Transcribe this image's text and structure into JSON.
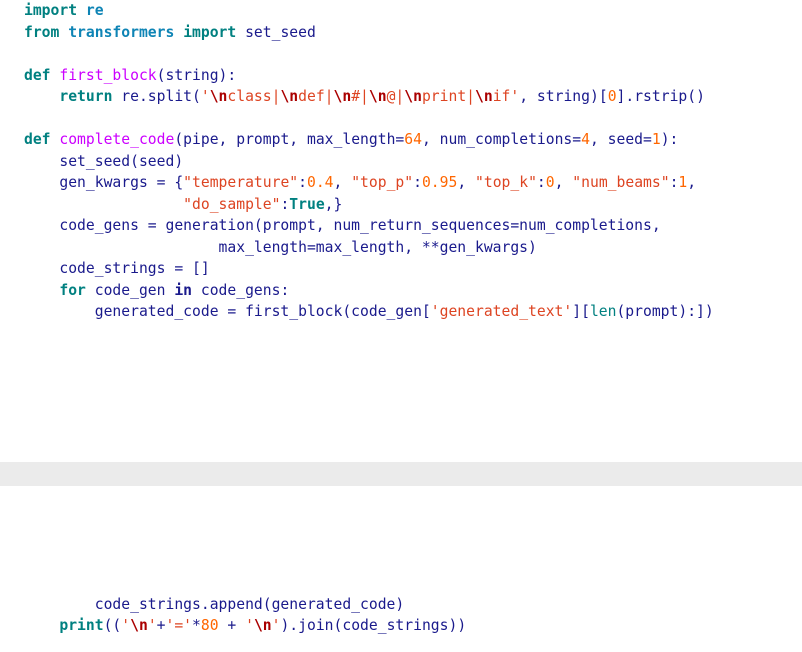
{
  "document": {
    "type": "python-source-listing",
    "language": "Python",
    "background_color": "#ffffff",
    "separator_band_color": "#ebebeb"
  },
  "theme": {
    "keyword_color": "#008080",
    "namespace_color": "#0e84b5",
    "function_name_color": "#cc00ff",
    "identifier_color": "#1a1a8c",
    "number_color": "#ff6600",
    "string_color": "#dd4422",
    "escape_color": "#aa0000",
    "builtin_color": "#008080"
  },
  "top_block": {
    "lines": [
      {
        "n": 1,
        "text": "import re",
        "tokens": [
          {
            "t": "import",
            "c": "kw"
          },
          {
            "t": " ",
            "c": "name"
          },
          {
            "t": "re",
            "c": "ns"
          }
        ]
      },
      {
        "n": 2,
        "text": "from transformers import set_seed",
        "tokens": [
          {
            "t": "from",
            "c": "kw"
          },
          {
            "t": " ",
            "c": "name"
          },
          {
            "t": "transformers",
            "c": "ns"
          },
          {
            "t": " ",
            "c": "name"
          },
          {
            "t": "import",
            "c": "kw"
          },
          {
            "t": " set_seed",
            "c": "name"
          }
        ]
      },
      {
        "n": 3,
        "text": "",
        "tokens": []
      },
      {
        "n": 4,
        "text": "def first_block(string):",
        "tokens": [
          {
            "t": "def",
            "c": "kw"
          },
          {
            "t": " ",
            "c": "name"
          },
          {
            "t": "first_block",
            "c": "fn"
          },
          {
            "t": "(string):",
            "c": "name"
          }
        ]
      },
      {
        "n": 5,
        "text": "    return re.split('\\nclass|\\ndef|\\n#|\\n@|\\nprint|\\nif', string)[0].rstrip()",
        "tokens": [
          {
            "t": "    ",
            "c": "name"
          },
          {
            "t": "return",
            "c": "kw"
          },
          {
            "t": " re.split(",
            "c": "name"
          },
          {
            "t": "'",
            "c": "str"
          },
          {
            "t": "\\n",
            "c": "esc"
          },
          {
            "t": "class|",
            "c": "str"
          },
          {
            "t": "\\n",
            "c": "esc"
          },
          {
            "t": "def|",
            "c": "str"
          },
          {
            "t": "\\n",
            "c": "esc"
          },
          {
            "t": "#|",
            "c": "str"
          },
          {
            "t": "\\n",
            "c": "esc"
          },
          {
            "t": "@|",
            "c": "str"
          },
          {
            "t": "\\n",
            "c": "esc"
          },
          {
            "t": "print|",
            "c": "str"
          },
          {
            "t": "\\n",
            "c": "esc"
          },
          {
            "t": "if'",
            "c": "str"
          },
          {
            "t": ", string)[",
            "c": "name"
          },
          {
            "t": "0",
            "c": "num"
          },
          {
            "t": "].rstrip()",
            "c": "name"
          }
        ]
      },
      {
        "n": 6,
        "text": "",
        "tokens": []
      },
      {
        "n": 7,
        "text": "def complete_code(pipe, prompt, max_length=64, num_completions=4, seed=1):",
        "tokens": [
          {
            "t": "def",
            "c": "kw"
          },
          {
            "t": " ",
            "c": "name"
          },
          {
            "t": "complete_code",
            "c": "fn"
          },
          {
            "t": "(pipe, prompt, max_length=",
            "c": "name"
          },
          {
            "t": "64",
            "c": "num"
          },
          {
            "t": ", num_completions=",
            "c": "name"
          },
          {
            "t": "4",
            "c": "num"
          },
          {
            "t": ", seed=",
            "c": "name"
          },
          {
            "t": "1",
            "c": "num"
          },
          {
            "t": "):",
            "c": "name"
          }
        ]
      },
      {
        "n": 8,
        "text": "    set_seed(seed)",
        "tokens": [
          {
            "t": "    set_seed(seed)",
            "c": "name"
          }
        ]
      },
      {
        "n": 9,
        "text": "    gen_kwargs = {\"temperature\":0.4, \"top_p\":0.95, \"top_k\":0, \"num_beams\":1,",
        "tokens": [
          {
            "t": "    gen_kwargs = {",
            "c": "name"
          },
          {
            "t": "\"temperature\"",
            "c": "str"
          },
          {
            "t": ":",
            "c": "name"
          },
          {
            "t": "0.4",
            "c": "num"
          },
          {
            "t": ", ",
            "c": "name"
          },
          {
            "t": "\"top_p\"",
            "c": "str"
          },
          {
            "t": ":",
            "c": "name"
          },
          {
            "t": "0.95",
            "c": "num"
          },
          {
            "t": ", ",
            "c": "name"
          },
          {
            "t": "\"top_k\"",
            "c": "str"
          },
          {
            "t": ":",
            "c": "name"
          },
          {
            "t": "0",
            "c": "num"
          },
          {
            "t": ", ",
            "c": "name"
          },
          {
            "t": "\"num_beams\"",
            "c": "str"
          },
          {
            "t": ":",
            "c": "name"
          },
          {
            "t": "1",
            "c": "num"
          },
          {
            "t": ",",
            "c": "name"
          }
        ]
      },
      {
        "n": 10,
        "text": "                  \"do_sample\":True,}",
        "tokens": [
          {
            "t": "                  ",
            "c": "name"
          },
          {
            "t": "\"do_sample\"",
            "c": "str"
          },
          {
            "t": ":",
            "c": "name"
          },
          {
            "t": "True",
            "c": "const"
          },
          {
            "t": ",}",
            "c": "name"
          }
        ]
      },
      {
        "n": 11,
        "text": "    code_gens = generation(prompt, num_return_sequences=num_completions,",
        "tokens": [
          {
            "t": "    code_gens = generation(prompt, num_return_sequences=num_completions,",
            "c": "name"
          }
        ]
      },
      {
        "n": 12,
        "text": "                      max_length=max_length, **gen_kwargs)",
        "tokens": [
          {
            "t": "                      max_length=max_length, **gen_kwargs)",
            "c": "name"
          }
        ]
      },
      {
        "n": 13,
        "text": "    code_strings = []",
        "tokens": [
          {
            "t": "    code_strings = []",
            "c": "name"
          }
        ]
      },
      {
        "n": 14,
        "text": "    for code_gen in code_gens:",
        "tokens": [
          {
            "t": "    ",
            "c": "name"
          },
          {
            "t": "for",
            "c": "kw"
          },
          {
            "t": " code_gen ",
            "c": "name"
          },
          {
            "t": "in",
            "c": "kw-in"
          },
          {
            "t": " code_gens:",
            "c": "name"
          }
        ]
      },
      {
        "n": 15,
        "text": "        generated_code = first_block(code_gen['generated_text'][len(prompt):])",
        "tokens": [
          {
            "t": "        generated_code = first_block(code_gen[",
            "c": "name"
          },
          {
            "t": "'generated_text'",
            "c": "str"
          },
          {
            "t": "][",
            "c": "name"
          },
          {
            "t": "len",
            "c": "builtin"
          },
          {
            "t": "(prompt):])",
            "c": "name"
          }
        ]
      }
    ]
  },
  "bottom_block": {
    "lines": [
      {
        "n": 1,
        "text": "",
        "tokens": []
      },
      {
        "n": 2,
        "text": "",
        "tokens": []
      },
      {
        "n": 3,
        "text": "",
        "tokens": []
      },
      {
        "n": 4,
        "text": "",
        "tokens": []
      },
      {
        "n": 5,
        "text": "",
        "tokens": []
      },
      {
        "n": 6,
        "text": "        code_strings.append(generated_code)",
        "tokens": [
          {
            "t": "        code_strings.append(generated_code)",
            "c": "name"
          }
        ]
      },
      {
        "n": 7,
        "text": "    print(('\\n'+'='*80 + '\\n').join(code_strings))",
        "tokens": [
          {
            "t": "    ",
            "c": "name"
          },
          {
            "t": "print",
            "c": "print"
          },
          {
            "t": "((",
            "c": "name"
          },
          {
            "t": "'",
            "c": "str"
          },
          {
            "t": "\\n",
            "c": "esc"
          },
          {
            "t": "'",
            "c": "str"
          },
          {
            "t": "+",
            "c": "name"
          },
          {
            "t": "'='",
            "c": "str"
          },
          {
            "t": "*",
            "c": "name"
          },
          {
            "t": "80",
            "c": "num"
          },
          {
            "t": " + ",
            "c": "name"
          },
          {
            "t": "'",
            "c": "str"
          },
          {
            "t": "\\n",
            "c": "esc"
          },
          {
            "t": "'",
            "c": "str"
          },
          {
            "t": ").join(code_strings))",
            "c": "name"
          }
        ]
      }
    ]
  }
}
